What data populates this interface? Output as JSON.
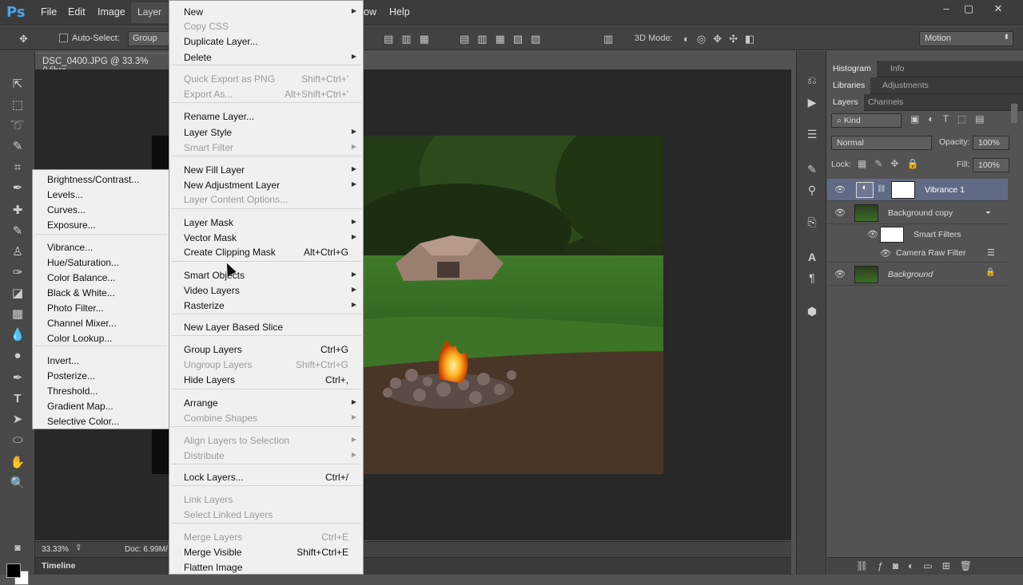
{
  "app": {
    "logo": "Ps",
    "menus": [
      "File",
      "Edit",
      "Image",
      "Layer"
    ],
    "menus_right": [
      "ow",
      "Help"
    ],
    "window_controls": [
      "–",
      "▢",
      "✕"
    ]
  },
  "options": {
    "auto_select_label": "Auto-Select:",
    "group_value": "Group",
    "mode_3d_label": "3D Mode:",
    "workspace_value": "Motion"
  },
  "document": {
    "tab_title": "DSC_0400.JPG @ 33.3% (Vibra",
    "zoom": "33.33%",
    "doc_info": "Doc: 6.99M/"
  },
  "timeline": {
    "label": "Timeline"
  },
  "layer_menu": {
    "items": [
      {
        "label": "New",
        "arrow": true
      },
      {
        "label": "Copy CSS",
        "disabled": true
      },
      {
        "label": "Duplicate Layer..."
      },
      {
        "label": "Delete",
        "arrow": true
      },
      {
        "label": "Quick Export as PNG",
        "shortcut": "Shift+Ctrl+'",
        "disabled": true
      },
      {
        "label": "Export As...",
        "shortcut": "Alt+Shift+Ctrl+'",
        "disabled": true
      },
      {
        "label": "Rename Layer..."
      },
      {
        "label": "Layer Style",
        "arrow": true
      },
      {
        "label": "Smart Filter",
        "arrow": true,
        "disabled": true
      },
      {
        "label": "New Fill Layer",
        "arrow": true
      },
      {
        "label": "New Adjustment Layer",
        "arrow": true
      },
      {
        "label": "Layer Content Options...",
        "disabled": true
      },
      {
        "label": "Layer Mask",
        "arrow": true
      },
      {
        "label": "Vector Mask",
        "arrow": true
      },
      {
        "label": "Create Clipping Mask",
        "shortcut": "Alt+Ctrl+G"
      },
      {
        "label": "Smart Objects",
        "arrow": true
      },
      {
        "label": "Video Layers",
        "arrow": true
      },
      {
        "label": "Rasterize",
        "arrow": true
      },
      {
        "label": "New Layer Based Slice"
      },
      {
        "label": "Group Layers",
        "shortcut": "Ctrl+G"
      },
      {
        "label": "Ungroup Layers",
        "shortcut": "Shift+Ctrl+G",
        "disabled": true
      },
      {
        "label": "Hide Layers",
        "shortcut": "Ctrl+,"
      },
      {
        "label": "Arrange",
        "arrow": true
      },
      {
        "label": "Combine Shapes",
        "arrow": true,
        "disabled": true
      },
      {
        "label": "Align Layers to Selection",
        "arrow": true,
        "disabled": true
      },
      {
        "label": "Distribute",
        "arrow": true,
        "disabled": true
      },
      {
        "label": "Lock Layers...",
        "shortcut": "Ctrl+/"
      },
      {
        "label": "Link Layers",
        "disabled": true
      },
      {
        "label": "Select Linked Layers",
        "disabled": true
      },
      {
        "label": "Merge Layers",
        "shortcut": "Ctrl+E",
        "disabled": true
      },
      {
        "label": "Merge Visible",
        "shortcut": "Shift+Ctrl+E"
      },
      {
        "label": "Flatten Image"
      }
    ]
  },
  "adjustment_menu": {
    "items": [
      "Brightness/Contrast...",
      "Levels...",
      "Curves...",
      "Exposure...",
      "Vibrance...",
      "Hue/Saturation...",
      "Color Balance...",
      "Black & White...",
      "Photo Filter...",
      "Channel Mixer...",
      "Color Lookup...",
      "Invert...",
      "Posterize...",
      "Threshold...",
      "Gradient Map...",
      "Selective Color..."
    ]
  },
  "panels": {
    "tabs_top": [
      "Histogram",
      "Info"
    ],
    "tabs_mid": [
      "Libraries",
      "Adjustments"
    ],
    "tabs_layers": [
      "Layers",
      "Channels"
    ],
    "filter_kind": "Kind",
    "blend_mode": "Normal",
    "opacity_label": "Opacity:",
    "opacity_value": "100%",
    "lock_label": "Lock:",
    "fill_label": "Fill:",
    "fill_value": "100%",
    "layers": [
      "Vibrance 1",
      "Background copy",
      "Smart Filters",
      "Camera Raw Filter",
      "Background"
    ],
    "bottom_icons": [
      "link-icon",
      "fx-icon",
      "mask-icon",
      "adjustment-icon",
      "folder-icon",
      "new-layer-icon",
      "trash-icon"
    ]
  },
  "colors": {
    "accent": "#4aa3e8",
    "selected_layer": "#5f6b85"
  }
}
